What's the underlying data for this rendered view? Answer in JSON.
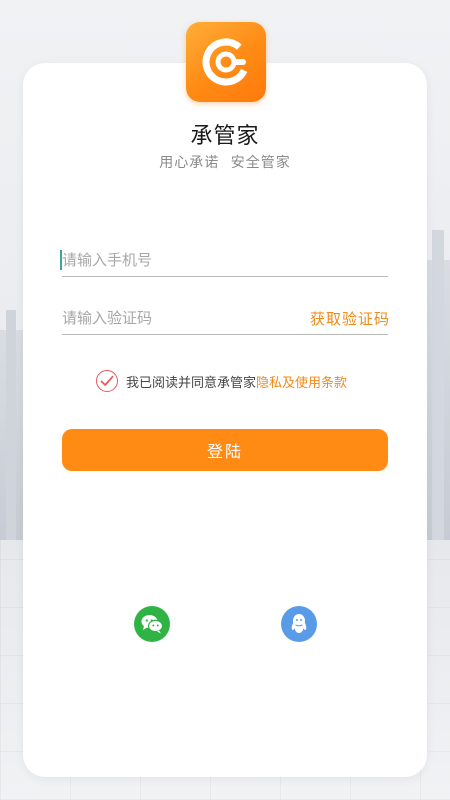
{
  "app": {
    "name": "承管家",
    "slogan": "用心承诺 安全管家"
  },
  "form": {
    "phone_placeholder": "请输入手机号",
    "code_placeholder": "请输入验证码",
    "get_code_label": "获取验证码"
  },
  "agreement": {
    "checked": true,
    "text": "我已阅读并同意承管家",
    "link_label": "隐私及使用条款"
  },
  "login_button_label": "登陆",
  "social_logins": [
    {
      "name": "wechat",
      "icon": "wechat-icon",
      "color": "#2fb345"
    },
    {
      "name": "qq",
      "icon": "qq-icon",
      "color": "#5a9be8"
    }
  ],
  "colors": {
    "accent": "#ff8a14",
    "link": "#f08a1a",
    "check": "#e85a5a"
  }
}
